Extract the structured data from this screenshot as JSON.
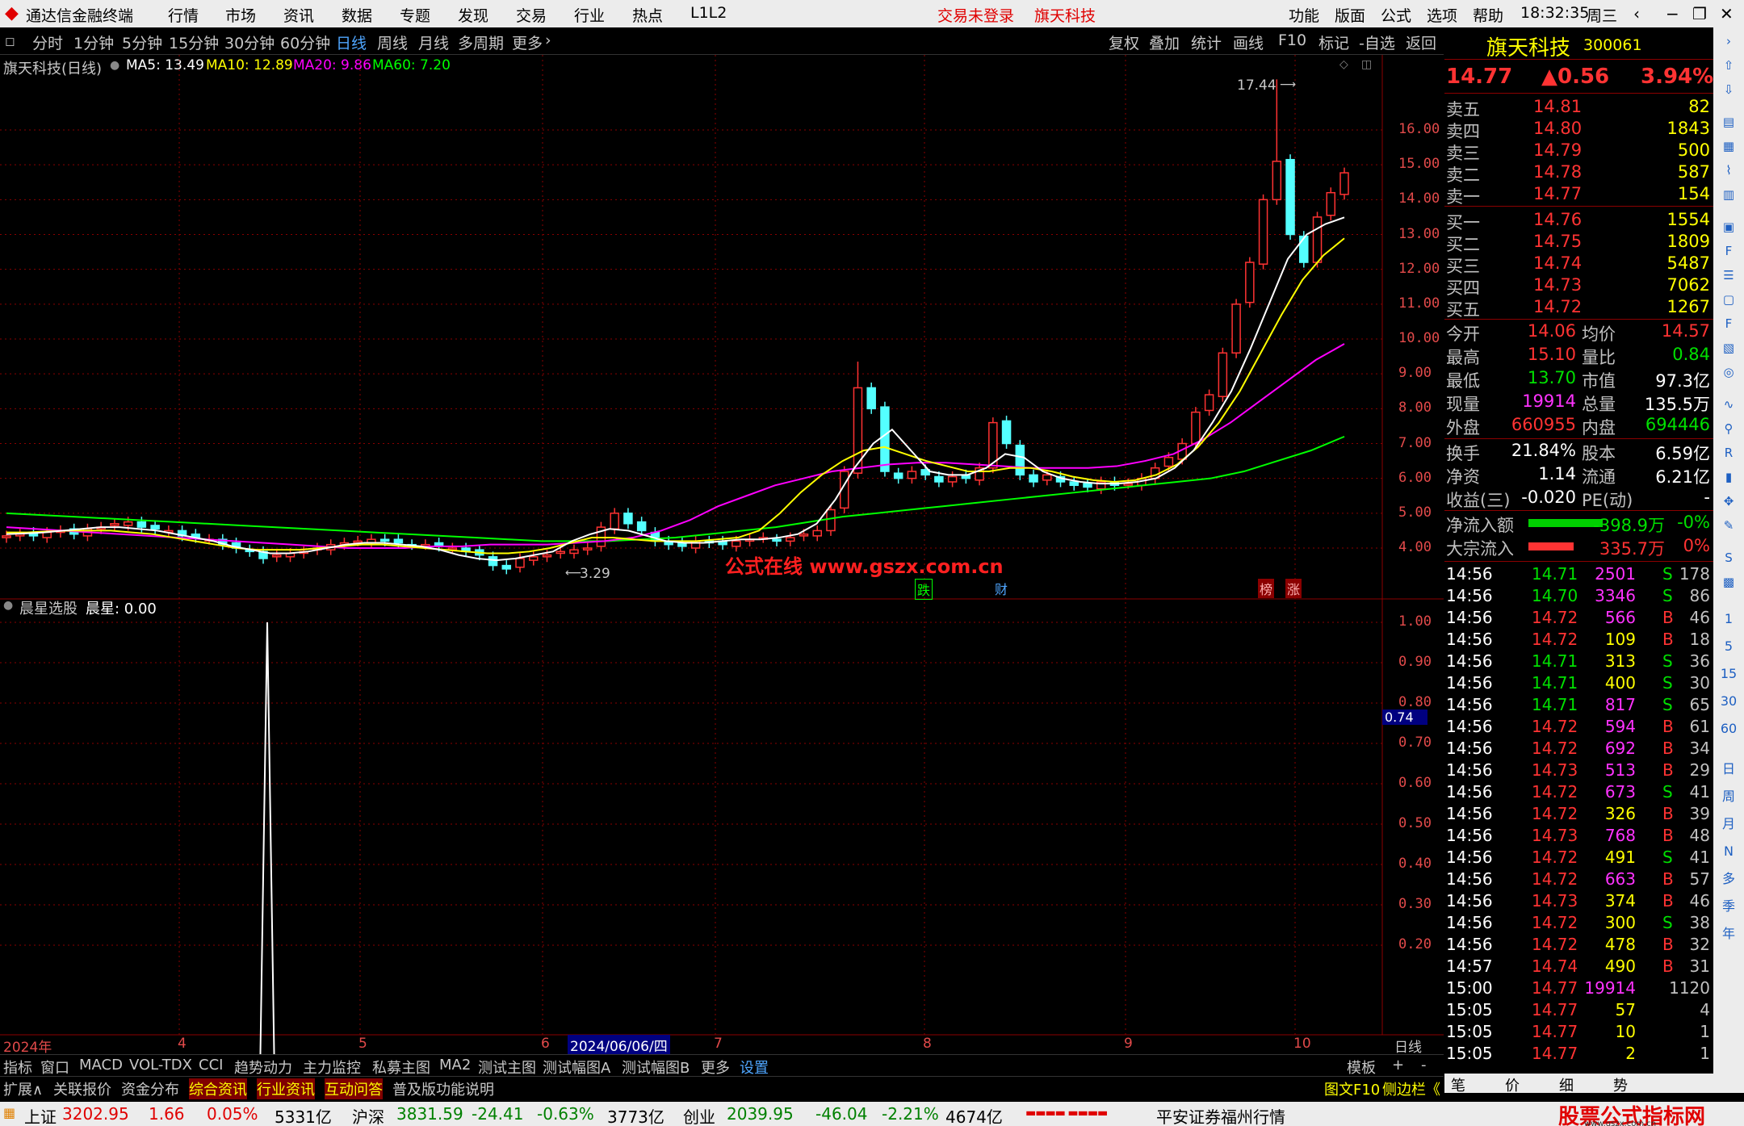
{
  "titlebar": {
    "app_name": "通达信金融终端",
    "menus": [
      "行情",
      "市场",
      "资讯",
      "数据",
      "专题",
      "发现",
      "交易",
      "行业",
      "热点",
      "L1L2"
    ],
    "login_status": "交易未登录",
    "stock_name": "旗天科技",
    "right_menus": [
      "功能",
      "版面",
      "公式",
      "选项",
      "帮助"
    ],
    "time": "18:32:35",
    "weekday": "周三"
  },
  "periodbar": {
    "periods": [
      "分时",
      "1分钟",
      "5分钟",
      "15分钟",
      "30分钟",
      "60分钟",
      "日线",
      "周线",
      "月线",
      "多周期",
      "更多"
    ],
    "active": "日线",
    "tools": [
      "复权",
      "叠加",
      "统计",
      "画线",
      "F10",
      "标记",
      "-自选",
      "返回"
    ]
  },
  "main_chart": {
    "title": "旗天科技(日线)",
    "ma": [
      {
        "label": "MA5: 13.49",
        "color": "#ffffff"
      },
      {
        "label": "MA10: 12.89",
        "color": "#ffff00"
      },
      {
        "label": "MA20: 9.86",
        "color": "#ff00ff"
      },
      {
        "label": "MA60: 7.20",
        "color": "#00ff00"
      }
    ],
    "y_labels": [
      "16.00",
      "15.00",
      "14.00",
      "13.00",
      "12.00",
      "11.00",
      "10.00",
      "9.00",
      "8.00",
      "7.00",
      "6.00",
      "5.00",
      "4.00"
    ],
    "high_marker": "17.44",
    "low_marker": "3.29",
    "watermark": "公式在线  www.gszx.com.cn",
    "event_tags": [
      "跌",
      "财",
      "榜",
      "涨"
    ]
  },
  "indicator": {
    "name": "晨星选股",
    "value_label": "晨星: 0.00",
    "y_labels": [
      "1.00",
      "0.90",
      "0.80",
      "0.70",
      "0.60",
      "0.50",
      "0.40",
      "0.30",
      "0.20"
    ],
    "cursor_value": "0.74"
  },
  "x_axis": {
    "labels": [
      "2024年",
      "4",
      "5",
      "6",
      "7",
      "8",
      "9",
      "10"
    ],
    "cursor_date": "2024/06/06/四",
    "period_label": "日线"
  },
  "tabs_row1": [
    "指标",
    "窗口",
    "MACD",
    "VOL-TDX",
    "CCI",
    "趋势动力",
    "主力监控",
    "私募主图",
    "MA2",
    "测试主图",
    "测试幅图A",
    "测试幅图B",
    "更多",
    "设置"
  ],
  "tabs_row1_right": [
    "模板",
    "+",
    "-"
  ],
  "tabs_row2": [
    "扩展∧",
    "关联报价",
    "资金分布",
    "综合资讯",
    "行业资讯",
    "互动问答",
    "普及版功能说明"
  ],
  "tabs_row2_right": [
    "图文F10",
    "侧边栏《"
  ],
  "right_panel": {
    "name": "旗天科技",
    "code": "300061",
    "price": "14.77",
    "change": "▲0.56",
    "change_pct": "3.94%",
    "sells": [
      {
        "label": "卖五",
        "price": "14.81",
        "vol": "82"
      },
      {
        "label": "卖四",
        "price": "14.80",
        "vol": "1843"
      },
      {
        "label": "卖三",
        "price": "14.79",
        "vol": "500"
      },
      {
        "label": "卖二",
        "price": "14.78",
        "vol": "587"
      },
      {
        "label": "卖一",
        "price": "14.77",
        "vol": "154"
      }
    ],
    "buys": [
      {
        "label": "买一",
        "price": "14.76",
        "vol": "1554"
      },
      {
        "label": "买二",
        "price": "14.75",
        "vol": "1809"
      },
      {
        "label": "买三",
        "price": "14.74",
        "vol": "5487"
      },
      {
        "label": "买四",
        "price": "14.73",
        "vol": "7062"
      },
      {
        "label": "买五",
        "price": "14.72",
        "vol": "1267"
      }
    ],
    "stats": [
      {
        "l1": "今开",
        "v1": "14.06",
        "c1": "red",
        "l2": "均价",
        "v2": "14.57",
        "c2": "red"
      },
      {
        "l1": "最高",
        "v1": "15.10",
        "c1": "red",
        "l2": "量比",
        "v2": "0.84",
        "c2": "green"
      },
      {
        "l1": "最低",
        "v1": "13.70",
        "c1": "green",
        "l2": "市值",
        "v2": "97.3亿",
        "c2": "white"
      },
      {
        "l1": "现量",
        "v1": "19914",
        "c1": "magenta",
        "l2": "总量",
        "v2": "135.5万",
        "c2": "white"
      },
      {
        "l1": "外盘",
        "v1": "660955",
        "c1": "red",
        "l2": "内盘",
        "v2": "694446",
        "c2": "green"
      }
    ],
    "stats2": [
      {
        "l1": "换手",
        "v1": "21.84%",
        "l2": "股本",
        "v2": "6.59亿"
      },
      {
        "l1": "净资",
        "v1": "1.14",
        "l2": "流通",
        "v2": "6.21亿"
      },
      {
        "l1": "收益(三)",
        "v1": "-0.020",
        "l2": "PE(动)",
        "v2": "-"
      }
    ],
    "flows": [
      {
        "label": "净流入额",
        "value": "-398.9万",
        "pct": "-0%",
        "bar": "#00d000",
        "color": "green"
      },
      {
        "label": "大宗流入",
        "value": "335.7万",
        "pct": "0%",
        "bar": "#ff3333",
        "color": "red"
      }
    ],
    "ticks": [
      {
        "t": "14:56",
        "p": "14.71",
        "pc": "green",
        "v": "2501",
        "vc": "magenta",
        "s": "S",
        "n": "178"
      },
      {
        "t": "14:56",
        "p": "14.70",
        "pc": "green",
        "v": "3346",
        "vc": "magenta",
        "s": "S",
        "n": "86"
      },
      {
        "t": "14:56",
        "p": "14.72",
        "pc": "red",
        "v": "566",
        "vc": "magenta",
        "s": "B",
        "n": "46"
      },
      {
        "t": "14:56",
        "p": "14.72",
        "pc": "red",
        "v": "109",
        "vc": "yellow",
        "s": "B",
        "n": "18"
      },
      {
        "t": "14:56",
        "p": "14.71",
        "pc": "green",
        "v": "313",
        "vc": "yellow",
        "s": "S",
        "n": "36"
      },
      {
        "t": "14:56",
        "p": "14.71",
        "pc": "green",
        "v": "400",
        "vc": "yellow",
        "s": "S",
        "n": "30"
      },
      {
        "t": "14:56",
        "p": "14.71",
        "pc": "green",
        "v": "817",
        "vc": "magenta",
        "s": "S",
        "n": "65"
      },
      {
        "t": "14:56",
        "p": "14.72",
        "pc": "red",
        "v": "594",
        "vc": "magenta",
        "s": "B",
        "n": "61"
      },
      {
        "t": "14:56",
        "p": "14.72",
        "pc": "red",
        "v": "692",
        "vc": "magenta",
        "s": "B",
        "n": "34"
      },
      {
        "t": "14:56",
        "p": "14.73",
        "pc": "red",
        "v": "513",
        "vc": "magenta",
        "s": "B",
        "n": "29"
      },
      {
        "t": "14:56",
        "p": "14.72",
        "pc": "red",
        "v": "673",
        "vc": "magenta",
        "s": "S",
        "n": "41"
      },
      {
        "t": "14:56",
        "p": "14.72",
        "pc": "red",
        "v": "326",
        "vc": "yellow",
        "s": "B",
        "n": "39"
      },
      {
        "t": "14:56",
        "p": "14.73",
        "pc": "red",
        "v": "768",
        "vc": "magenta",
        "s": "B",
        "n": "48"
      },
      {
        "t": "14:56",
        "p": "14.72",
        "pc": "red",
        "v": "491",
        "vc": "yellow",
        "s": "S",
        "n": "41"
      },
      {
        "t": "14:56",
        "p": "14.72",
        "pc": "red",
        "v": "663",
        "vc": "magenta",
        "s": "B",
        "n": "57"
      },
      {
        "t": "14:56",
        "p": "14.73",
        "pc": "red",
        "v": "374",
        "vc": "yellow",
        "s": "B",
        "n": "46"
      },
      {
        "t": "14:56",
        "p": "14.72",
        "pc": "red",
        "v": "300",
        "vc": "yellow",
        "s": "S",
        "n": "38"
      },
      {
        "t": "14:56",
        "p": "14.72",
        "pc": "red",
        "v": "478",
        "vc": "yellow",
        "s": "B",
        "n": "32"
      },
      {
        "t": "14:57",
        "p": "14.74",
        "pc": "red",
        "v": "490",
        "vc": "yellow",
        "s": "B",
        "n": "31"
      },
      {
        "t": "15:00",
        "p": "14.77",
        "pc": "red",
        "v": "19914",
        "vc": "magenta",
        "s": "",
        "n": "1120"
      },
      {
        "t": "15:05",
        "p": "14.77",
        "pc": "red",
        "v": "57",
        "vc": "yellow",
        "s": "",
        "n": "4"
      },
      {
        "t": "15:05",
        "p": "14.77",
        "pc": "red",
        "v": "10",
        "vc": "yellow",
        "s": "",
        "n": "1"
      },
      {
        "t": "15:05",
        "p": "14.77",
        "pc": "red",
        "v": "2",
        "vc": "yellow",
        "s": "",
        "n": "1"
      }
    ],
    "bottom_tabs": [
      "笔",
      "价",
      "细",
      "势"
    ]
  },
  "side_toolbar": [
    "1",
    "5",
    "15",
    "30",
    "60",
    "日",
    "周",
    "月",
    "N",
    "多",
    "季",
    "年"
  ],
  "statusbar": {
    "items": [
      {
        "text": "上证",
        "c": ""
      },
      {
        "text": "3202.95",
        "c": "sred"
      },
      {
        "text": "1.66",
        "c": "sred"
      },
      {
        "text": "0.05%",
        "c": "sred"
      },
      {
        "text": "5331亿",
        "c": ""
      },
      {
        "text": "沪深",
        "c": ""
      },
      {
        "text": "3831.59",
        "c": "sgreen"
      },
      {
        "text": "-24.41",
        "c": "sgreen"
      },
      {
        "text": "-0.63%",
        "c": "sgreen"
      },
      {
        "text": "3773亿",
        "c": ""
      },
      {
        "text": "创业",
        "c": ""
      },
      {
        "text": "2039.95",
        "c": "sgreen"
      },
      {
        "text": "-46.04",
        "c": "sgreen"
      },
      {
        "text": "-2.21%",
        "c": "sgreen"
      },
      {
        "text": "4674亿",
        "c": ""
      },
      {
        "text": "平安证券福州行情",
        "c": ""
      }
    ],
    "brand": "股票公式指标网",
    "brand_url": "www.gszx.com.cn"
  },
  "chart_data": {
    "type": "candlestick",
    "title": "旗天科技(日线)",
    "y_range": [
      3.29,
      17.44
    ],
    "x_labels": [
      "2024年",
      "4",
      "5",
      "6",
      "7",
      "8",
      "9",
      "10"
    ],
    "ma_latest": {
      "MA5": 13.49,
      "MA10": 12.89,
      "MA20": 9.86,
      "MA60": 7.2
    },
    "close": [
      4.35,
      4.4,
      4.35,
      4.45,
      4.5,
      4.4,
      4.55,
      4.6,
      4.7,
      4.75,
      4.6,
      4.55,
      4.5,
      4.35,
      4.3,
      4.25,
      4.1,
      4.0,
      3.9,
      3.7,
      3.8,
      3.85,
      3.9,
      4.0,
      4.1,
      4.15,
      4.2,
      4.25,
      4.2,
      4.15,
      4.1,
      4.1,
      4.05,
      4.0,
      3.9,
      3.8,
      3.5,
      3.4,
      3.7,
      3.75,
      3.8,
      3.9,
      3.95,
      4.0,
      4.6,
      5.0,
      4.7,
      4.5,
      4.2,
      4.1,
      4.05,
      4.2,
      4.15,
      4.1,
      4.2,
      4.25,
      4.3,
      4.2,
      4.3,
      4.4,
      4.5,
      5.1,
      6.2,
      8.6,
      8.0,
      6.2,
      6.0,
      6.2,
      6.1,
      5.9,
      6.05,
      6.0,
      6.3,
      7.6,
      7.0,
      6.1,
      5.9,
      6.1,
      5.9,
      5.8,
      5.75,
      5.9,
      5.8,
      5.85,
      6.0,
      6.3,
      6.6,
      7.0,
      7.9,
      8.4,
      9.6,
      11.0,
      12.2,
      14.0,
      15.1,
      13.0,
      12.2,
      13.5,
      14.2,
      14.77
    ],
    "ma5": [
      4.4,
      4.42,
      4.45,
      4.5,
      4.55,
      4.6,
      4.6,
      4.55,
      4.5,
      4.4,
      4.3,
      4.2,
      4.05,
      3.95,
      3.85,
      3.85,
      3.9,
      4.0,
      4.1,
      4.15,
      4.15,
      4.1,
      4.05,
      3.95,
      3.8,
      3.7,
      3.65,
      3.7,
      3.8,
      3.9,
      4.2,
      4.4,
      4.55,
      4.5,
      4.35,
      4.2,
      4.15,
      4.15,
      4.2,
      4.25,
      4.25,
      4.3,
      4.4,
      4.7,
      5.4,
      6.3,
      7.0,
      7.4,
      6.8,
      6.2,
      6.1,
      6.1,
      6.3,
      6.7,
      6.6,
      6.2,
      6.0,
      5.9,
      5.85,
      5.85,
      5.9,
      6.0,
      6.3,
      6.8,
      7.6,
      8.5,
      9.7,
      11.0,
      12.3,
      13.0,
      13.3,
      13.49
    ],
    "ma10": [
      4.45,
      4.45,
      4.48,
      4.5,
      4.5,
      4.5,
      4.45,
      4.4,
      4.3,
      4.2,
      4.1,
      4.0,
      3.95,
      3.95,
      3.95,
      4.0,
      4.05,
      4.1,
      4.1,
      4.05,
      4.0,
      3.95,
      3.9,
      3.85,
      3.85,
      3.9,
      4.0,
      4.15,
      4.3,
      4.3,
      4.25,
      4.2,
      4.2,
      4.2,
      4.25,
      4.3,
      4.5,
      5.0,
      5.6,
      6.1,
      6.5,
      6.8,
      6.9,
      6.7,
      6.5,
      6.35,
      6.2,
      6.2,
      6.3,
      6.3,
      6.2,
      6.05,
      5.95,
      5.9,
      5.95,
      6.1,
      6.4,
      6.9,
      7.6,
      8.5,
      9.6,
      10.7,
      11.7,
      12.4,
      12.89
    ],
    "ma20": [
      4.6,
      4.55,
      4.5,
      4.45,
      4.4,
      4.35,
      4.3,
      4.25,
      4.2,
      4.15,
      4.1,
      4.05,
      4.0,
      4.0,
      4.0,
      4.05,
      4.05,
      4.1,
      4.1,
      4.1,
      4.15,
      4.2,
      4.3,
      4.5,
      4.8,
      5.2,
      5.5,
      5.8,
      6.0,
      6.2,
      6.3,
      6.4,
      6.45,
      6.45,
      6.4,
      6.35,
      6.3,
      6.3,
      6.3,
      6.35,
      6.5,
      6.7,
      7.1,
      7.6,
      8.2,
      8.8,
      9.4,
      9.86
    ],
    "ma60": [
      5.0,
      4.95,
      4.9,
      4.85,
      4.8,
      4.75,
      4.7,
      4.65,
      4.6,
      4.55,
      4.5,
      4.45,
      4.4,
      4.35,
      4.3,
      4.25,
      4.2,
      4.2,
      4.2,
      4.25,
      4.3,
      4.4,
      4.5,
      4.6,
      4.75,
      4.9,
      5.0,
      5.1,
      5.2,
      5.3,
      5.4,
      5.5,
      5.6,
      5.7,
      5.8,
      5.9,
      6.0,
      6.2,
      6.5,
      6.8,
      7.2
    ]
  }
}
